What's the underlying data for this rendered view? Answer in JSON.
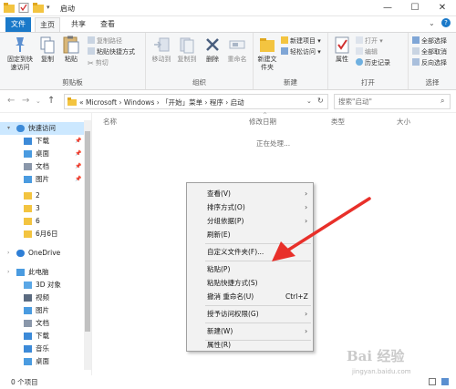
{
  "window": {
    "title": "启动",
    "minimize": "—",
    "maximize": "☐",
    "close": "✕"
  },
  "ribbon_tabs": [
    "文件",
    "主页",
    "共享",
    "查看"
  ],
  "ribbon": {
    "clipboard": {
      "label": "剪贴板",
      "pin_to_quick": "固定到快速访问",
      "copy": "复制",
      "paste": "粘贴",
      "copy_path": "复制路径",
      "paste_shortcut": "粘贴快捷方式",
      "cut": "剪切"
    },
    "organize": {
      "label": "组织",
      "move_to": "移动到",
      "copy_to": "复制到",
      "delete": "删除",
      "rename": "重命名"
    },
    "new": {
      "label": "新建",
      "new_folder": "新建文件夹",
      "new_item": "新建项目 ▾",
      "easy_access": "轻松访问 ▾"
    },
    "open": {
      "label": "打开",
      "properties": "属性",
      "open": "打开 ▾",
      "edit": "编辑",
      "history": "历史记录"
    },
    "select": {
      "label": "选择",
      "select_all": "全部选择",
      "select_none": "全部取消",
      "invert": "反向选择"
    }
  },
  "address": {
    "path": "«  Microsoft  ›  Windows  ›  「开始」菜单  ›  程序  ›  启动",
    "search_placeholder": "搜索\"启动\""
  },
  "nav": {
    "items": [
      {
        "label": "快速访问",
        "icon": "star-icon",
        "pinned": false
      },
      {
        "label": "下载",
        "icon": "download-icon",
        "pinned": true
      },
      {
        "label": "桌面",
        "icon": "desktop-icon",
        "pinned": true
      },
      {
        "label": "文档",
        "icon": "document-icon",
        "pinned": true
      },
      {
        "label": "图片",
        "icon": "picture-icon",
        "pinned": true
      },
      {
        "label": "2",
        "icon": "folder-icon",
        "pinned": false
      },
      {
        "label": "3",
        "icon": "folder-icon",
        "pinned": false
      },
      {
        "label": "6",
        "icon": "folder-icon",
        "pinned": false
      },
      {
        "label": "6月6日",
        "icon": "folder-icon",
        "pinned": false
      },
      {
        "label": "OneDrive",
        "icon": "cloud-icon",
        "pinned": false
      },
      {
        "label": "此电脑",
        "icon": "computer-icon",
        "pinned": false
      },
      {
        "label": "3D 对象",
        "icon": "cube-icon",
        "pinned": false
      },
      {
        "label": "视频",
        "icon": "video-icon",
        "pinned": false
      },
      {
        "label": "图片",
        "icon": "picture-icon",
        "pinned": false
      },
      {
        "label": "文档",
        "icon": "document-icon",
        "pinned": false
      },
      {
        "label": "下载",
        "icon": "download-icon",
        "pinned": false
      },
      {
        "label": "音乐",
        "icon": "music-icon",
        "pinned": false
      },
      {
        "label": "桌面",
        "icon": "desktop-icon",
        "pinned": false
      }
    ],
    "pin_glyph": "📌"
  },
  "columns": {
    "name": "名称",
    "modified": "修改日期",
    "type": "类型",
    "size": "大小"
  },
  "content": {
    "status": "正在处理..."
  },
  "statusbar": {
    "count": "0 个项目"
  },
  "context_menu": {
    "view": "查看(V)",
    "sort": "排序方式(O)",
    "group": "分组依据(P)",
    "refresh": "刷新(E)",
    "customize": "自定义文件夹(F)...",
    "paste": "粘贴(P)",
    "paste_shortcut": "粘贴快捷方式(S)",
    "undo_rename": "撤消 重命名(U)",
    "undo_shortcut": "Ctrl+Z",
    "grant_access": "授予访问权限(G)",
    "new": "新建(W)",
    "properties": "属性(R)"
  },
  "watermark": {
    "brand": "Bai 经验",
    "url": "jingyan.baidu.com"
  },
  "colors": {
    "accent": "#1a79c9",
    "arrow": "#e8302a",
    "folder": "#f3c440",
    "selected": "#cce8ff"
  }
}
